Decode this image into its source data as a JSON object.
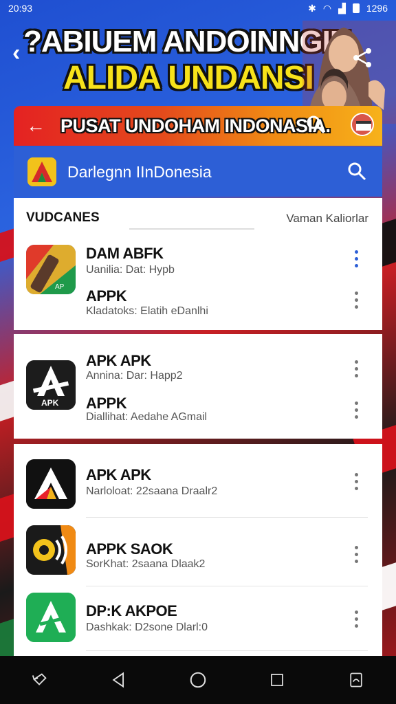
{
  "status": {
    "time": "20:93",
    "right_time": "1296"
  },
  "banner": {
    "line1": "?ABIUEM ANDOINNGIN",
    "line2": "ALIDA UNDANSI ?"
  },
  "app_header": {
    "title": "PUSAT UNDOHAM INDONASIA."
  },
  "search_bar": {
    "text": "Darlegnn IInDonesia"
  },
  "section": {
    "title": "VUDCANES",
    "right_label": "Vaman Kaliorlar"
  },
  "items": [
    {
      "title": "DAM ABFK",
      "subtitle": "Uanilia: Dat: Hypb"
    },
    {
      "title": "APPK",
      "subtitle": "Kladatoks: Elatih eDanlhi"
    },
    {
      "title": "APK APK",
      "subtitle": "Annina: Dar: Happ2"
    },
    {
      "title": "APPK",
      "subtitle": "Diallihat: Aedahe AGmail"
    },
    {
      "title": "APK APK",
      "subtitle": "Narloloat: 22saana Draalr2"
    },
    {
      "title": "APPK SAOK",
      "subtitle": "SorKhat: 2saana Dlaak2"
    },
    {
      "title": "DP:K AKPOE",
      "subtitle": "Dashkak: D2sone Dlarl:0"
    }
  ],
  "icon_label": {
    "apk": "APK",
    "ap": "AP"
  },
  "icons": {
    "back": "back-arrow-icon",
    "share": "share-icon",
    "search": "search-icon",
    "more": "more-vert-icon",
    "nav": [
      "rotate-icon",
      "back-triangle-icon",
      "home-circle-icon",
      "recents-square-icon",
      "screenshot-icon"
    ]
  },
  "colors": {
    "accent_blue": "#2d5fd6",
    "header_red": "#e42222",
    "header_orange": "#f7b21a",
    "banner_yellow": "#f7e21a"
  }
}
